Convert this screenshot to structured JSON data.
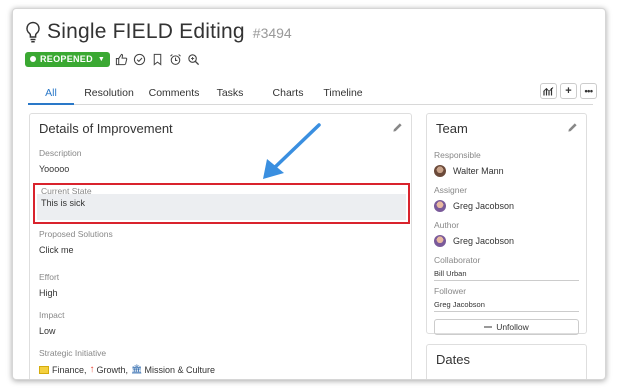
{
  "header": {
    "title": "Single FIELD Editing",
    "issue_id": "#3494",
    "status": "REOPENED",
    "icons": [
      "like-icon",
      "check-circle-icon",
      "bookmark-icon",
      "alarm-icon",
      "zoom-icon"
    ]
  },
  "tabs": [
    {
      "label": "All",
      "active": true
    },
    {
      "label": "Resolution",
      "active": false
    },
    {
      "label": "Comments",
      "active": false
    },
    {
      "label": "Tasks",
      "active": false
    },
    {
      "label": "Charts",
      "active": false
    },
    {
      "label": "Timeline",
      "active": false
    }
  ],
  "tab_actions": [
    "chart-icon",
    "plus-icon",
    "more-icon"
  ],
  "details": {
    "title": "Details of Improvement",
    "fields": {
      "description": {
        "label": "Description",
        "value": "Yooooo"
      },
      "current_state": {
        "label": "Current State",
        "value": "This is sick"
      },
      "proposed_solutions": {
        "label": "Proposed Solutions",
        "value": "Click me"
      },
      "effort": {
        "label": "Effort",
        "value": "High"
      },
      "impact": {
        "label": "Impact",
        "value": "Low"
      },
      "strategic_initiative": {
        "label": "Strategic Initiative",
        "items": [
          "Finance,",
          "Growth,",
          "Mission & Culture"
        ]
      }
    }
  },
  "team": {
    "title": "Team",
    "responsible": {
      "label": "Responsible",
      "name": "Walter Mann"
    },
    "assigner": {
      "label": "Assigner",
      "name": "Greg Jacobson"
    },
    "author": {
      "label": "Author",
      "name": "Greg Jacobson"
    },
    "collaborator": {
      "label": "Collaborator",
      "name": "Bill Urban"
    },
    "follower": {
      "label": "Follower",
      "name": "Greg Jacobson"
    },
    "unfollow_label": "Unfollow"
  },
  "dates": {
    "title": "Dates"
  },
  "colors": {
    "status_green": "#3aa832",
    "tab_active": "#2a78c8",
    "highlight_red": "#d9232d",
    "arrow_blue": "#3a8fe0"
  }
}
